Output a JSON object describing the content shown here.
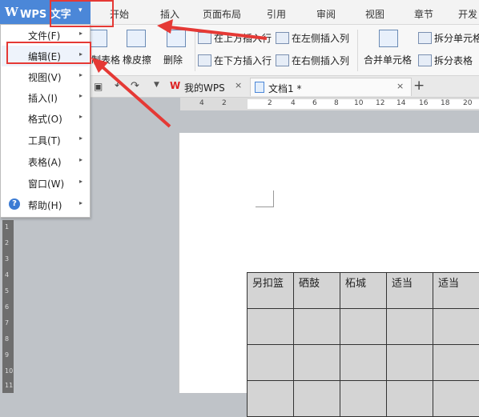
{
  "app": {
    "logo": "W",
    "title": "WPS 文字",
    "caret": "▾"
  },
  "ribbon_tabs": [
    "开始",
    "插入",
    "页面布局",
    "引用",
    "审阅",
    "视图",
    "章节",
    "开发"
  ],
  "ribbon": {
    "draw_table": "制表格",
    "eraser": "橡皮擦",
    "delete": "删除",
    "insert_row_above": "在上方插入行",
    "insert_row_below": "在下方插入行",
    "insert_col_left": "在左侧插入列",
    "insert_col_right": "在右侧插入列",
    "merge_cells": "合并单元格",
    "split_cells": "拆分单元格",
    "split_table": "拆分表格"
  },
  "doc_tabs": {
    "wps_tab": "我的WPS",
    "doc_tab": "文档1 *",
    "close": "×",
    "add": "+"
  },
  "ruler_numbers": [
    "4",
    "2",
    "2",
    "4",
    "6",
    "8",
    "10",
    "12",
    "14",
    "16",
    "18",
    "20"
  ],
  "vruler_numbers": [
    "1",
    "2",
    "3",
    "4",
    "5",
    "6",
    "7",
    "8",
    "9",
    "10",
    "11"
  ],
  "menu": {
    "items": [
      {
        "label": "文件(F)"
      },
      {
        "label": "编辑(E)"
      },
      {
        "label": "视图(V)"
      },
      {
        "label": "插入(I)"
      },
      {
        "label": "格式(O)"
      },
      {
        "label": "工具(T)"
      },
      {
        "label": "表格(A)"
      },
      {
        "label": "窗口(W)"
      },
      {
        "label": "帮助(H)"
      }
    ],
    "arrow": "▸",
    "help_icon": "?"
  },
  "table": {
    "row0": [
      "另扣篮",
      "硒鼓",
      "柘城",
      "适当",
      "适当"
    ]
  },
  "icons": {
    "undo": "undo-icon",
    "redo": "redo-icon",
    "print_preview": "print-preview-icon",
    "wps_logo": "wps-logo-icon"
  },
  "colors": {
    "accent": "#4b87d8",
    "annotation": "#e53935"
  }
}
